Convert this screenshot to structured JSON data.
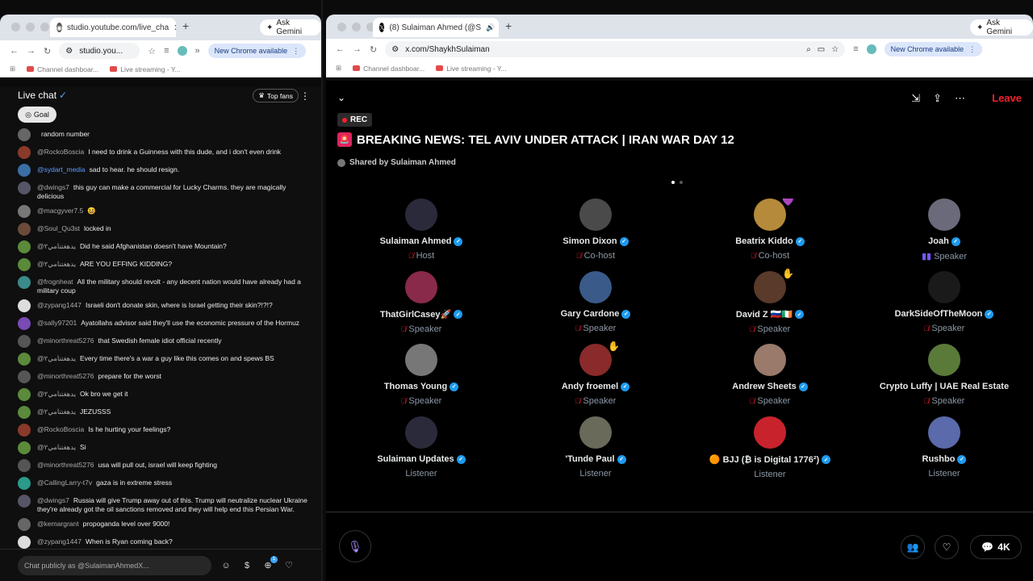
{
  "left_browser": {
    "tab_title": "studio.youtube.com/live_cha",
    "omnibox": "studio.you...",
    "update_label": "New Chrome available",
    "gemini_label": "Ask Gemini",
    "bookmarks": [
      "Channel dashboar...",
      "Live streaming - Y..."
    ]
  },
  "chat": {
    "title": "Live chat",
    "top_fans": "Top fans",
    "goal": "Goal",
    "messages": [
      {
        "author": "",
        "text": "random number",
        "color": "#666"
      },
      {
        "author": "@RockoBoscia",
        "text": "I need to drink a Guinness with this dude, and i don't even drink",
        "color": "#8a3a2a"
      },
      {
        "author": "@sydart_media",
        "text": "sad to hear. he should resign.",
        "color": "#3a6ea5"
      },
      {
        "author": "@dwings7",
        "text": "this guy can make a commercial for Lucky Charms. they are magically delicious",
        "color": "#556"
      },
      {
        "author": "@macgyver7.5",
        "text": "😆",
        "color": "#777"
      },
      {
        "author": "@Soul_Qu3st",
        "text": "locked in",
        "color": "#6b4a3a"
      },
      {
        "author": "@يدهغتنامي٢",
        "text": "Did he said Afghanistan doesn't have Mountain?",
        "color": "#5a8a3a"
      },
      {
        "author": "@يدهغتنامي٢",
        "text": "ARE YOU EFFING KIDDING?",
        "color": "#5a8a3a"
      },
      {
        "author": "@frognheat",
        "text": "All the military should revolt - any decent nation would have already had a military coup",
        "color": "#3a8a8a"
      },
      {
        "author": "@zypang1447",
        "text": "Israeli don't donate skin, where is Israel getting their skin?!?!?",
        "color": "#ddd"
      },
      {
        "author": "@sally97201",
        "text": "Ayatollahs advisor said they'll use the economic pressure of the Hormuz",
        "color": "#7a4ab5"
      },
      {
        "author": "@minorthreat5276",
        "text": "that Swedish female idiot official recently",
        "color": "#555"
      },
      {
        "author": "@يدهغتنامي٢",
        "text": "Every time there's a war a guy like this comes on and spews BS",
        "color": "#5a8a3a"
      },
      {
        "author": "@minorthreat5276",
        "text": "prepare for the worst",
        "color": "#555"
      },
      {
        "author": "@يدهغتنامي٢",
        "text": "Ok bro we get it",
        "color": "#5a8a3a"
      },
      {
        "author": "@يدهغتنامي٢",
        "text": "JEZUSSS",
        "color": "#5a8a3a"
      },
      {
        "author": "@RockoBoscia",
        "text": "Is he hurting your feelings?",
        "color": "#8a3a2a"
      },
      {
        "author": "@يدهغتنامي٢",
        "text": "Si",
        "color": "#5a8a3a"
      },
      {
        "author": "@minorthreat5276",
        "text": "usa will pull out, israel will keep fighting",
        "color": "#555"
      },
      {
        "author": "@CallingLarry-t7v",
        "text": "gaza is in extreme stress",
        "color": "#2a9a8a"
      },
      {
        "author": "@dwings7",
        "text": "Russia will give Trump away out of this. Trump will neutralize nuclear Ukraine they're already got the oil sanctions removed and they will help end this Persian War.",
        "color": "#556"
      },
      {
        "author": "@kemargrant",
        "text": "propoganda level over 9000!",
        "color": "#666"
      },
      {
        "author": "@zypang1447",
        "text": "When is Ryan coming back?",
        "color": "#ddd"
      }
    ],
    "input_placeholder": "Chat publicly as @SulaimanAhmedX...",
    "badge_count": "1"
  },
  "right_browser": {
    "tab_title": "(8) Sulaiman Ahmed (@S",
    "omnibox": "x.com/ShaykhSulaiman",
    "update_label": "New Chrome available",
    "gemini_label": "Ask Gemini",
    "bookmarks": [
      "Channel dashboar...",
      "Live streaming - Y..."
    ]
  },
  "space": {
    "rec": "REC",
    "title": "BREAKING NEWS: TEL AVIV UNDER ATTACK | IRAN WAR DAY 12",
    "shared_by": "Shared by Sulaiman Ahmed",
    "leave": "Leave",
    "listener_count": "4K",
    "participants": [
      {
        "name": "Sulaiman Ahmed",
        "role": "Host",
        "verified": true,
        "muted": true,
        "color": "#2a2a3a",
        "emoji": ""
      },
      {
        "name": "Simon Dixon",
        "role": "Co-host",
        "verified": true,
        "muted": true,
        "color": "#4a4a4a",
        "emoji": ""
      },
      {
        "name": "Beatrix Kiddo",
        "role": "Co-host",
        "verified": true,
        "muted": true,
        "color": "#b58a3a",
        "emoji": "💜"
      },
      {
        "name": "Joah",
        "role": "Speaker",
        "verified": true,
        "muted": false,
        "color": "#6a6a7a",
        "emoji": ""
      },
      {
        "name": "ThatGirlCasey🚀",
        "role": "Speaker",
        "verified": true,
        "muted": true,
        "color": "#8a2a4a",
        "emoji": ""
      },
      {
        "name": "Gary Cardone",
        "role": "Speaker",
        "verified": true,
        "muted": true,
        "color": "#3a5a8a",
        "emoji": ""
      },
      {
        "name": "David Z 🇷🇺🇮🇪",
        "role": "Speaker",
        "verified": true,
        "muted": true,
        "color": "#5a3a2a",
        "emoji": "✋"
      },
      {
        "name": "DarkSideOfTheMoon",
        "role": "Speaker",
        "verified": true,
        "muted": true,
        "color": "#1a1a1a",
        "emoji": ""
      },
      {
        "name": "Thomas Young",
        "role": "Speaker",
        "verified": true,
        "muted": true,
        "color": "#777",
        "emoji": ""
      },
      {
        "name": "Andy froemel",
        "role": "Speaker",
        "verified": true,
        "muted": true,
        "color": "#8a2a2a",
        "emoji": "✋"
      },
      {
        "name": "Andrew Sheets",
        "role": "Speaker",
        "verified": true,
        "muted": true,
        "color": "#9a7a6a",
        "emoji": ""
      },
      {
        "name": "Crypto Luffy | UAE Real Estate",
        "role": "Speaker",
        "verified": false,
        "muted": true,
        "color": "#5a7a3a",
        "emoji": ""
      },
      {
        "name": "Sulaiman Updates",
        "role": "Listener",
        "verified": true,
        "muted": false,
        "color": "#2a2a3a",
        "emoji": ""
      },
      {
        "name": "'Tunde Paul",
        "role": "Listener",
        "verified": true,
        "muted": false,
        "color": "#6a6a5a",
        "emoji": ""
      },
      {
        "name": "🟠 BJJ (₿ is Digital 1776²)",
        "role": "Listener",
        "verified": true,
        "muted": false,
        "color": "#c8232c",
        "emoji": ""
      },
      {
        "name": "Rushbo",
        "role": "Listener",
        "verified": true,
        "muted": false,
        "color": "#5a6aaa",
        "emoji": ""
      }
    ]
  }
}
